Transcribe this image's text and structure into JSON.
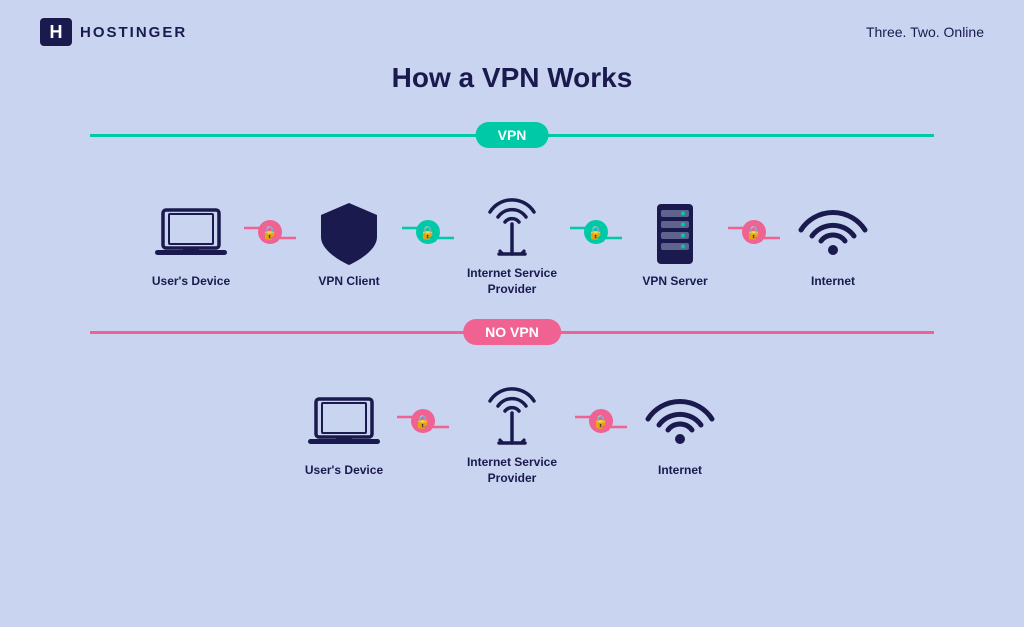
{
  "header": {
    "logo_text": "HOSTINGER",
    "tagline": "Three. Two. Online"
  },
  "page": {
    "title": "How a VPN Works"
  },
  "vpn_section": {
    "badge": "VPN",
    "items": [
      {
        "id": "user-device-vpn",
        "label": "User's Device"
      },
      {
        "id": "vpn-client",
        "label": "VPN Client"
      },
      {
        "id": "isp-vpn",
        "label": "Internet Service\nProvider"
      },
      {
        "id": "vpn-server",
        "label": "VPN Server"
      },
      {
        "id": "internet-vpn",
        "label": "Internet"
      }
    ]
  },
  "novpn_section": {
    "badge": "NO VPN",
    "items": [
      {
        "id": "user-device-novpn",
        "label": "User's Device"
      },
      {
        "id": "isp-novpn",
        "label": "Internet Service\nProvider"
      },
      {
        "id": "internet-novpn",
        "label": "Internet"
      }
    ]
  },
  "colors": {
    "bg": "#c8d4f0",
    "dark": "#1a1a4e",
    "teal": "#00c9a7",
    "pink": "#f06292",
    "white": "#ffffff"
  }
}
